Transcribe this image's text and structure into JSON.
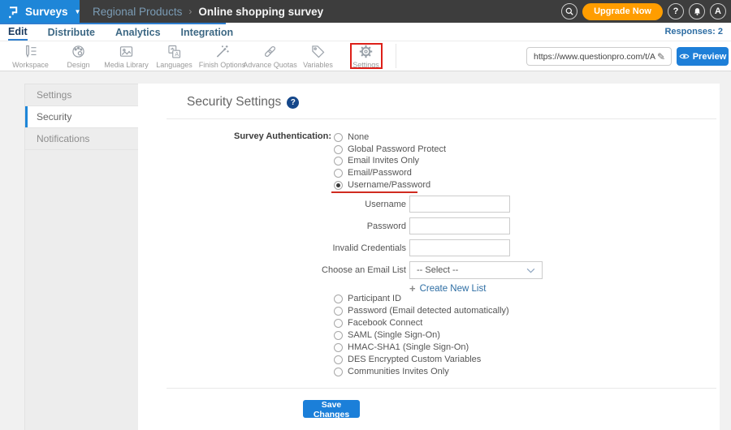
{
  "header": {
    "product_menu": "Surveys",
    "breadcrumb": {
      "parent": "Regional Products",
      "separator": "›",
      "current": "Online shopping survey"
    },
    "upgrade_button": "Upgrade Now",
    "help_badge": "?",
    "avatar_initial": "A"
  },
  "nav": {
    "tabs": [
      {
        "label": "Edit"
      },
      {
        "label": "Distribute"
      },
      {
        "label": "Analytics"
      },
      {
        "label": "Integration"
      }
    ],
    "active_tab": "Edit",
    "responses": "Responses: 2"
  },
  "toolbar": {
    "items": [
      {
        "label": "Workspace",
        "icon": "workspace-icon"
      },
      {
        "label": "Design",
        "icon": "design-icon"
      },
      {
        "label": "Media Library",
        "icon": "media-library-icon"
      },
      {
        "label": "Languages",
        "icon": "languages-icon"
      },
      {
        "label": "Finish Options",
        "icon": "finish-options-icon"
      },
      {
        "label": "Advance Quotas",
        "icon": "advance-quotas-icon"
      },
      {
        "label": "Variables",
        "icon": "variables-icon"
      },
      {
        "label": "Settings",
        "icon": "settings-icon",
        "highlighted": true
      }
    ],
    "survey_url": "https://www.questionpro.com/t/APNrFZ",
    "preview_button": "Preview"
  },
  "sidebar": {
    "items": [
      {
        "label": "Settings"
      },
      {
        "label": "Security"
      },
      {
        "label": "Notifications"
      }
    ],
    "active": "Security"
  },
  "content": {
    "title": "Security Settings",
    "auth_section": {
      "label": "Survey Authentication:",
      "options": [
        "None",
        "Global Password Protect",
        "Email Invites Only",
        "Email/Password",
        "Username/Password"
      ],
      "selected": "Username/Password"
    },
    "credential_fields": [
      {
        "label": "Username",
        "value": ""
      },
      {
        "label": "Password",
        "value": ""
      },
      {
        "label": "Invalid Credentials",
        "value": ""
      }
    ],
    "email_list": {
      "label": "Choose an Email List",
      "selected_option": "-- Select --"
    },
    "create_list_link": {
      "plus": "+",
      "label": "Create New List"
    },
    "more_options": [
      "Participant ID",
      "Password (Email detected automatically)",
      "Facebook Connect",
      "SAML (Single Sign-On)",
      "HMAC-SHA1 (Single Sign-On)",
      "DES Encrypted Custom Variables",
      "Communities Invites Only"
    ],
    "save_button": "Save Changes"
  },
  "annotations": {
    "highlighted_toolbar_item": "Settings",
    "underlined_option": "Username/Password"
  },
  "colors": {
    "brand_blue": "#1e86d8",
    "header_dark": "#3d3d3d",
    "accent_orange": "#ff9d00",
    "link_blue": "#2d6da3",
    "annotation_red": "#dd2019"
  }
}
